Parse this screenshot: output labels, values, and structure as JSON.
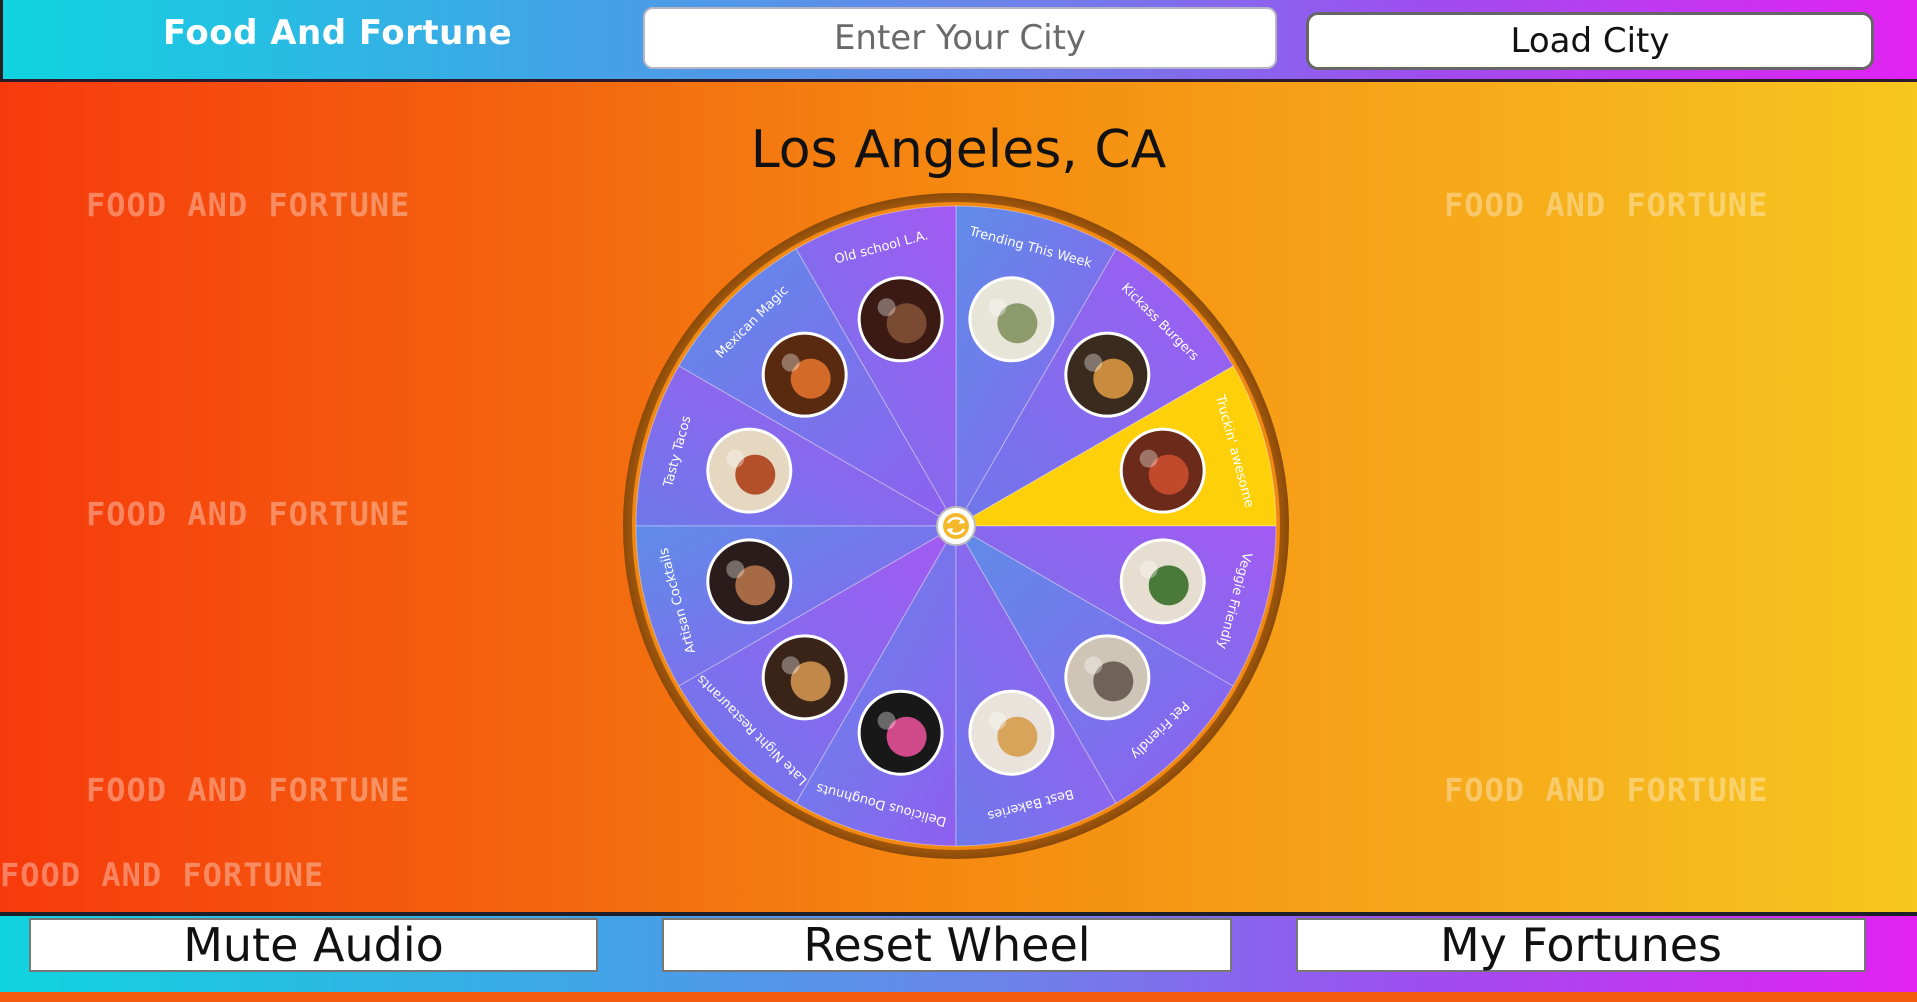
{
  "header": {
    "app_title": "Food And Fortune",
    "city_input_placeholder": "Enter Your City",
    "load_button_label": "Load City"
  },
  "main": {
    "city_heading": "Los Angeles, CA",
    "watermark_text": "FOOD AND FORTUNE",
    "wheel": {
      "highlight_color": "#fdd00a",
      "segment_colors": [
        "#6a80ea",
        "#9058ef"
      ],
      "highlighted_segment": "Truckin' awesome",
      "segments": [
        {
          "label": "Truckin' awesome",
          "image_icon": "food-truck-photo"
        },
        {
          "label": "Kickass Burgers",
          "image_icon": "burger-photo"
        },
        {
          "label": "Trending This Week",
          "image_icon": "trending-dish-photo"
        },
        {
          "label": "Old school L.A.",
          "image_icon": "restaurant-interior-photo"
        },
        {
          "label": "Mexican Magic",
          "image_icon": "mexican-dish-photo"
        },
        {
          "label": "Tasty Tacos",
          "image_icon": "tacos-photo"
        },
        {
          "label": "Artisan Cocktails",
          "image_icon": "cocktail-photo"
        },
        {
          "label": "Late Night Restaurants",
          "image_icon": "late-night-burger-photo"
        },
        {
          "label": "Delicious Doughnuts",
          "image_icon": "doughnuts-photo"
        },
        {
          "label": "Best Bakeries",
          "image_icon": "pastry-photo"
        },
        {
          "label": "Pet Friendly",
          "image_icon": "patio-photo"
        },
        {
          "label": "Veggie Friendly",
          "image_icon": "veggie-bowl-photo"
        }
      ]
    },
    "spin_icon": "refresh-icon"
  },
  "footer": {
    "mute_label": "Mute Audio",
    "reset_label": "Reset Wheel",
    "fortunes_label": "My Fortunes"
  }
}
